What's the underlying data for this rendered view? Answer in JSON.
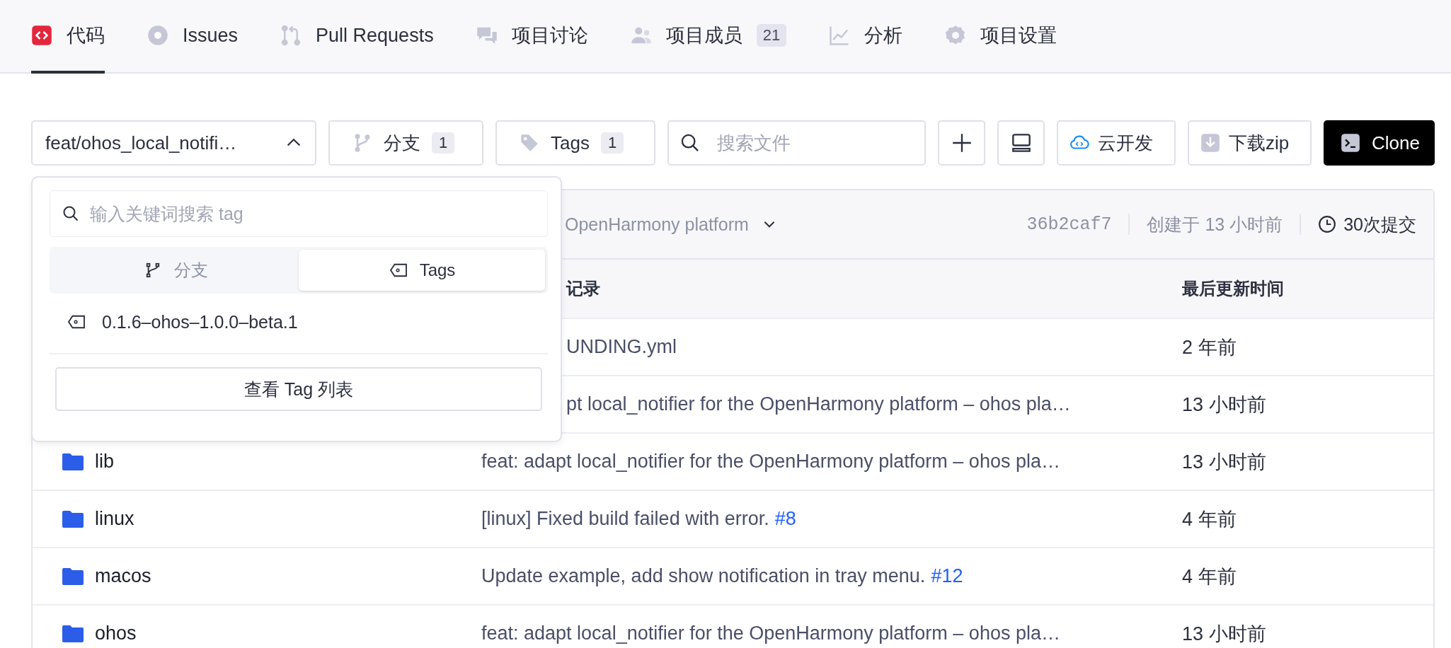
{
  "nav": {
    "tabs": [
      {
        "label": "代码",
        "selected": true
      },
      {
        "label": "Issues",
        "selected": false
      },
      {
        "label": "Pull Requests",
        "selected": false
      },
      {
        "label": "项目讨论",
        "selected": false
      },
      {
        "label": "项目成员",
        "selected": false,
        "badge": "21"
      },
      {
        "label": "分析",
        "selected": false
      },
      {
        "label": "项目设置",
        "selected": false
      }
    ]
  },
  "toolbar": {
    "branch_select": {
      "value": "feat/ohos_local_notifi…",
      "expanded": true
    },
    "branches": {
      "label": "分支",
      "count": "1"
    },
    "tags": {
      "label": "Tags",
      "count": "1"
    },
    "search": {
      "placeholder": "搜索文件"
    },
    "cloud_dev": "云开发",
    "download": "下载zip",
    "clone": "Clone"
  },
  "popup": {
    "search": {
      "placeholder": "输入关键词搜索 tag"
    },
    "tabs": [
      {
        "label": "分支",
        "selected": false
      },
      {
        "label": "Tags",
        "selected": true
      }
    ],
    "items": [
      {
        "label": "0.1.6–ohos–1.0.0–beta.1"
      }
    ],
    "footer_button": "查看 Tag 列表"
  },
  "commit_bar": {
    "message": "OpenHarmony platform",
    "hash": "36b2caf7",
    "created": "创建于 13 小时前",
    "commits": "30次提交"
  },
  "table": {
    "columns": [
      "记录",
      "最后更新时间"
    ],
    "rows": [
      {
        "commit": "UNDING.yml",
        "time": "2 年前"
      },
      {
        "commit": "pt local_notifier for the OpenHarmony platform – ohos pla…",
        "time": "13 小时前"
      },
      {
        "name": "lib",
        "commit": "feat: adapt local_notifier for the OpenHarmony platform – ohos pla…",
        "time": "13 小时前"
      },
      {
        "name": "linux",
        "commit": "[linux] Fixed build failed with error.",
        "link": "#8",
        "time": "4 年前"
      },
      {
        "name": "macos",
        "commit": "Update example, add show notification in tray menu.",
        "link": "#12",
        "time": "4 年前"
      },
      {
        "name": "ohos",
        "commit": "feat: adapt local_notifier for the OpenHarmony platform – ohos pla…",
        "time": "13 小时前"
      }
    ]
  }
}
